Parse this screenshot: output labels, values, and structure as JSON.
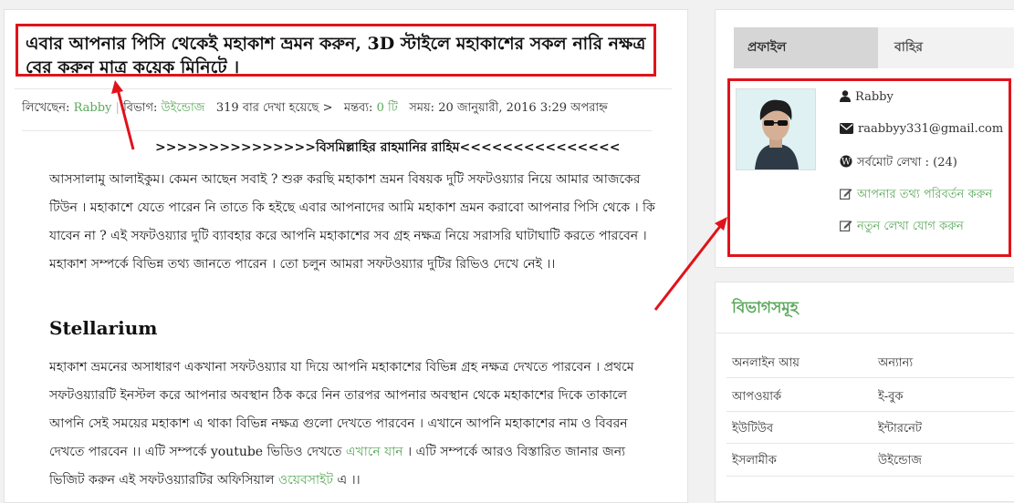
{
  "article": {
    "title": "এবার আপনার পিসি থেকেই মহাকাশ ভ্রমন করুন, 3D স্টাইলে মহাকাশের সকল নারি নক্ষত্র বের করুন মাত্র কয়েক মিনিটে ।",
    "meta": {
      "author_label": "লিখেছেন:",
      "author": "Rabby",
      "category_label": "বিভাগ:",
      "category": "উইন্ডোজ",
      "views": "319 বার দেখা হয়েছে",
      "views_glyph": ">",
      "comments_label": "মন্তব্য:",
      "comments": "0 টি",
      "time_label": "সময়:",
      "time": "20 জানুয়ারী, 2016 3:29 অপরাহ্ন"
    },
    "bismillah": ">>>>>>>>>>>>>>>বিসমিল্লাহির রাহমানির রাহিম<<<<<<<<<<<<<<<",
    "para1": "আসসালামু আলাইকুম। কেমন আছেন সবাই ? শুরু করছি মহাকাশ ভ্রমন বিষয়ক দুটি সফটওয়্যার নিয়ে আমার আজকের টিউন । মহাকাশে যেতে পারেন নি তাতে কি হইছে এবার আপনাদের আমি মহাকাশ ভ্রমন করাবো আপনার পিসি থেকে । কি যাবেন না ? এই সফটওয়্যার দুটি ব্যাবহার করে আপনি মহাকাশের সব গ্রহ নক্ষত্র নিয়ে সরাসরি ঘাটাঘাটি করতে পারবেন । মহাকাশ সম্পর্কে বিভিন্ন তথ্য জানতে পারেন । তো চলুন আমরা সফটওয়্যার দুটির রিভিও দেখে নেই ।।",
    "section_heading": "Stellarium",
    "para2_a": "মহাকাশ ভ্রমনের অসাধারণ একখানা সফটওয়্যার যা দিয়ে আপনি মহাকাশের বিভিন্ন গ্রহ নক্ষত্র দেখতে পারবেন । প্রথমে সফটওয়্যারটি ইনস্টল করে আপনার অবস্থান ঠিক করে নিন তারপর আপনার অবস্থান থেকে মহাকাশের দিকে তাকালে আপনি সেই সময়ের মহাকাশ এ থাকা বিভিন্ন নক্ষত্র গুলো দেখতে পারবেন । এখানে আপনি মহাকাশের নাম ও বিবরন দেখতে পারবেন ।। এটি সম্পর্কে youtube ভিডিও দেখতে ",
    "para2_link1": "এখানে যান",
    "para2_b": " । এটি সম্পর্কে আরও বিস্তারিত জানার জন্য ভিজিট করুন এই সফটওয়্যারটির অফিসিয়াল ",
    "para2_link2": "ওয়েবসাইট",
    "para2_c": " এ ।।"
  },
  "sidebar": {
    "tabs": [
      "প্রফাইল",
      "বাহির"
    ],
    "profile": {
      "name": "Rabby",
      "email": "raabbyy331@gmail.com",
      "posts": "সর্বমোট লেখা : (24)",
      "edit_link": "আপনার তথ্য পরিবর্তন করুন",
      "new_post_link": "নতুন লেখা যোগ করুন"
    },
    "categories_title": "বিভাগসমূহ",
    "categories": [
      [
        "অনলাইন আয়",
        "অন্যান্য"
      ],
      [
        "আপওয়ার্ক",
        "ই-বুক"
      ],
      [
        "ইউটিউব",
        "ইন্টারনেট"
      ],
      [
        "ইসলামীক",
        "উইন্ডোজ"
      ]
    ]
  },
  "colors": {
    "accent_green": "#5aa85a",
    "highlight_red": "#e0131b"
  }
}
